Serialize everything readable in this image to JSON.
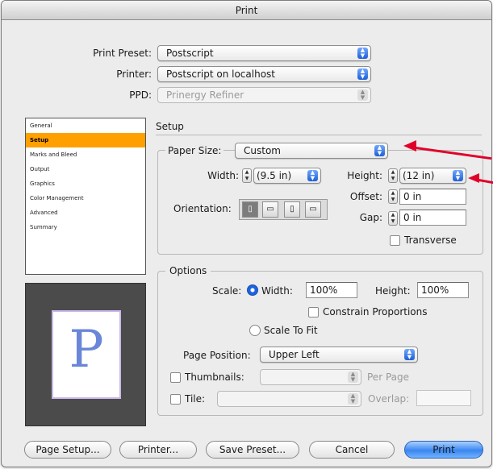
{
  "window": {
    "title": "Print"
  },
  "top": {
    "print_preset_label": "Print Preset:",
    "print_preset_value": "Postscript",
    "printer_label": "Printer:",
    "printer_value": "Postscript on localhost",
    "ppd_label": "PPD:",
    "ppd_value": "Prinergy Refiner"
  },
  "categories": [
    "General",
    "Setup",
    "Marks and Bleed",
    "Output",
    "Graphics",
    "Color Management",
    "Advanced",
    "Summary"
  ],
  "section_title": "Setup",
  "paper": {
    "paper_size_label": "Paper Size:",
    "paper_size_value": "Custom",
    "width_label": "Width:",
    "width_value": "(9.5 in)",
    "height_label": "Height:",
    "height_value": "(12 in)",
    "offset_label": "Offset:",
    "offset_value": "0 in",
    "gap_label": "Gap:",
    "gap_value": "0 in",
    "orientation_label": "Orientation:",
    "transverse_label": "Transverse"
  },
  "options": {
    "title": "Options",
    "scale_label": "Scale:",
    "width_label": "Width:",
    "width_value": "100%",
    "height_label": "Height:",
    "height_value": "100%",
    "constrain_label": "Constrain Proportions",
    "scale_to_fit_label": "Scale To Fit",
    "page_position_label": "Page Position:",
    "page_position_value": "Upper Left",
    "thumbnails_label": "Thumbnails:",
    "per_page_label": "Per Page",
    "tile_label": "Tile:",
    "overlap_label": "Overlap:"
  },
  "preview": {
    "letter": "P"
  },
  "buttons": {
    "page_setup": "Page Setup...",
    "printer": "Printer...",
    "save_preset": "Save Preset...",
    "cancel": "Cancel",
    "print": "Print"
  },
  "colors": {
    "selected_category": "#ffa000",
    "annotation_arrow": "#e1002a",
    "default_button": "#3a86f0"
  }
}
